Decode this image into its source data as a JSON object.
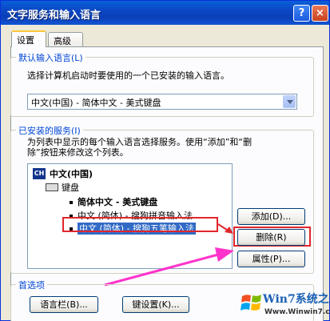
{
  "window": {
    "title": "文字服务和输入语言",
    "help_label": "?",
    "close_label": "×"
  },
  "tabs": [
    {
      "label": "设置",
      "active": true
    },
    {
      "label": "高级",
      "active": false
    }
  ],
  "default_language": {
    "legend": "默认输入语言(L)",
    "description": "选择计算机启动时要使用的一个已安装的输入语言。",
    "selected": "中文(中国) - 简体中文 - 美式键盘"
  },
  "installed_services": {
    "legend": "已安装的服务(I)",
    "description_line1": "为列表中显示的每个输入语言选择服务。使用“添加”和“删",
    "description_line2": "除”按钮来修改这个列表。",
    "tree": {
      "language_code": "CH",
      "language": "中文(中国)",
      "category": "键盘",
      "items": [
        {
          "label": "简体中文 - 美式键盘",
          "bold": true,
          "selected": false
        },
        {
          "label": "中文 (简体) - 搜狗拼音输入法",
          "bold": false,
          "selected": false
        },
        {
          "label": "中文 (简体) - 搜狗五笔输入法",
          "bold": false,
          "selected": true
        }
      ]
    },
    "buttons": {
      "add": "添加(D)...",
      "remove": "删除(R)",
      "properties": "属性(P)..."
    }
  },
  "preferences": {
    "legend": "首选项",
    "language_bar": "语言栏(B)...",
    "key_settings": "键设置(K)..."
  },
  "watermark": {
    "brand": "Win7系统之家",
    "url": "Www.Winwin7.com"
  },
  "colors": {
    "accent": "#0046d5",
    "selection": "#316ac5",
    "highlight_annotation": "#e0262b",
    "arrow_annotation": "#ff33cc"
  }
}
